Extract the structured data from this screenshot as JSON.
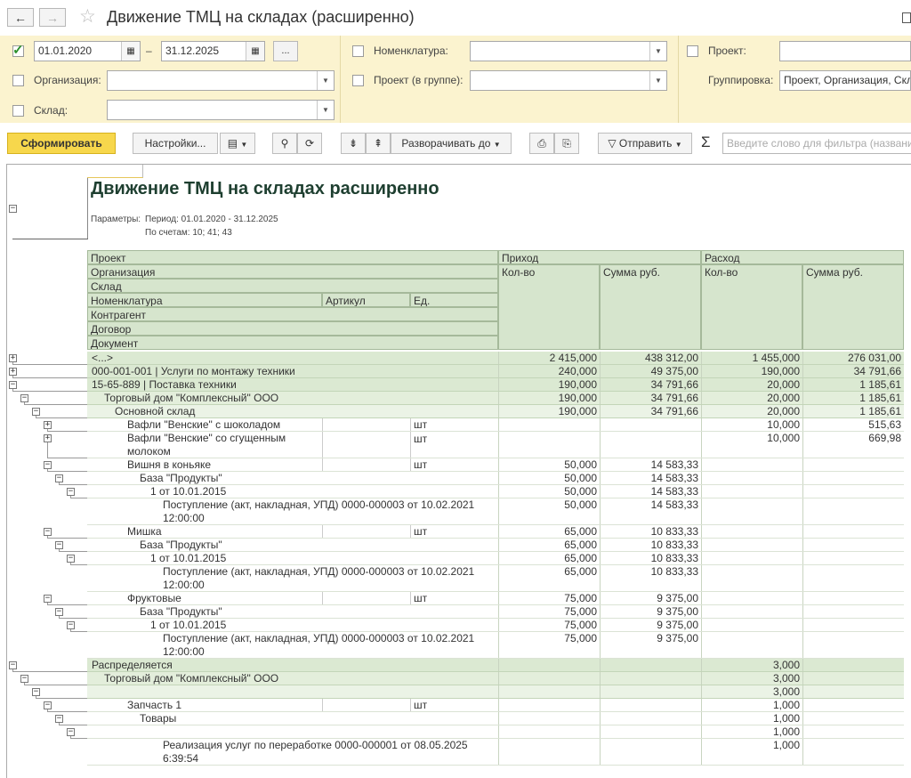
{
  "window": {
    "title": "Движение ТМЦ на складах (расширенно)",
    "back_icon": "←",
    "forward_icon": "→"
  },
  "filters": {
    "period": {
      "checked": true,
      "from": "01.01.2020",
      "dash": "–",
      "to": "31.12.2025",
      "more_label": "..."
    },
    "organization_label": "Организация:",
    "warehouse_label": "Склад:",
    "nomenclature_label": "Номенклатура:",
    "project_group_label": "Проект (в группе):",
    "project_label": "Проект:",
    "grouping_label": "Группировка:",
    "grouping_value": "Проект, Организация, Склад"
  },
  "toolbar": {
    "generate_label": "Сформировать",
    "settings_label": "Настройки...",
    "expand_label": "Разворачивать до",
    "send_label": "Отправить",
    "filter_placeholder": "Введите слово для фильтра (название"
  },
  "report": {
    "title": "Движение ТМЦ на складах расширенно",
    "param_label": "Параметры:",
    "param_period": "Период: 01.01.2020 - 31.12.2025",
    "param_accounts": "По счетам: 10; 41; 43",
    "headers": {
      "project": "Проект",
      "organization": "Организация",
      "warehouse": "Склад",
      "nomenclature": "Номенклатура",
      "article": "Артикул",
      "unit": "Ед.",
      "counterparty": "Контрагент",
      "contract": "Договор",
      "document": "Документ",
      "income": "Приход",
      "expense": "Расход",
      "qty": "Кол-во",
      "sum": "Сумма руб."
    },
    "rows": [
      {
        "level": 0,
        "name": "<...>",
        "unit": "",
        "in_qty": "2 415,000",
        "in_sum": "438 312,00",
        "out_qty": "1 455,000",
        "out_sum": "276 031,00",
        "tree": "+"
      },
      {
        "level": 0,
        "name": "000-001-001 | Услуги по монтажу техники",
        "unit": "",
        "in_qty": "240,000",
        "in_sum": "49 375,00",
        "out_qty": "190,000",
        "out_sum": "34 791,66",
        "tree": "+"
      },
      {
        "level": 0,
        "name": "15-65-889 | Поставка техники",
        "unit": "",
        "in_qty": "190,000",
        "in_sum": "34 791,66",
        "out_qty": "20,000",
        "out_sum": "1 185,61",
        "tree": "-"
      },
      {
        "level": 1,
        "name": "Торговый дом \"Комплексный\" ООО",
        "unit": "",
        "in_qty": "190,000",
        "in_sum": "34 791,66",
        "out_qty": "20,000",
        "out_sum": "1 185,61",
        "tree": "-"
      },
      {
        "level": 2,
        "name": "Основной склад",
        "unit": "",
        "in_qty": "190,000",
        "in_sum": "34 791,66",
        "out_qty": "20,000",
        "out_sum": "1 185,61",
        "tree": "-"
      },
      {
        "level": 3,
        "name": "Вафли \"Венские\" с шоколадом",
        "unit": "шт",
        "in_qty": "",
        "in_sum": "",
        "out_qty": "10,000",
        "out_sum": "515,63",
        "tree": "+"
      },
      {
        "level": 3,
        "name": "Вафли \"Венские\" со сгущенным",
        "name2": "молоком",
        "unit": "шт",
        "in_qty": "",
        "in_sum": "",
        "out_qty": "10,000",
        "out_sum": "669,98",
        "tree": "+"
      },
      {
        "level": 3,
        "name": "Вишня в коньяке",
        "unit": "шт",
        "in_qty": "50,000",
        "in_sum": "14 583,33",
        "out_qty": "",
        "out_sum": "",
        "tree": "-"
      },
      {
        "level": 4,
        "name": "База \"Продукты\"",
        "unit": "",
        "in_qty": "50,000",
        "in_sum": "14 583,33",
        "out_qty": "",
        "out_sum": "",
        "tree": "-"
      },
      {
        "level": 5,
        "name": "1 от 10.01.2015",
        "unit": "",
        "in_qty": "50,000",
        "in_sum": "14 583,33",
        "out_qty": "",
        "out_sum": "",
        "tree": "-"
      },
      {
        "level": 6,
        "name": "Поступление (акт, накладная, УПД) 0000-000003 от 10.02.2021",
        "name2": "12:00:00",
        "unit": "",
        "in_qty": "50,000",
        "in_sum": "14 583,33",
        "out_qty": "",
        "out_sum": ""
      },
      {
        "level": 3,
        "name": "Мишка",
        "unit": "шт",
        "in_qty": "65,000",
        "in_sum": "10 833,33",
        "out_qty": "",
        "out_sum": "",
        "tree": "-"
      },
      {
        "level": 4,
        "name": "База \"Продукты\"",
        "unit": "",
        "in_qty": "65,000",
        "in_sum": "10 833,33",
        "out_qty": "",
        "out_sum": "",
        "tree": "-"
      },
      {
        "level": 5,
        "name": "1 от 10.01.2015",
        "unit": "",
        "in_qty": "65,000",
        "in_sum": "10 833,33",
        "out_qty": "",
        "out_sum": "",
        "tree": "-"
      },
      {
        "level": 6,
        "name": "Поступление (акт, накладная, УПД) 0000-000003 от 10.02.2021",
        "name2": "12:00:00",
        "unit": "",
        "in_qty": "65,000",
        "in_sum": "10 833,33",
        "out_qty": "",
        "out_sum": ""
      },
      {
        "level": 3,
        "name": "Фруктовые",
        "unit": "шт",
        "in_qty": "75,000",
        "in_sum": "9 375,00",
        "out_qty": "",
        "out_sum": "",
        "tree": "-"
      },
      {
        "level": 4,
        "name": "База \"Продукты\"",
        "unit": "",
        "in_qty": "75,000",
        "in_sum": "9 375,00",
        "out_qty": "",
        "out_sum": "",
        "tree": "-"
      },
      {
        "level": 5,
        "name": "1 от 10.01.2015",
        "unit": "",
        "in_qty": "75,000",
        "in_sum": "9 375,00",
        "out_qty": "",
        "out_sum": "",
        "tree": "-"
      },
      {
        "level": 6,
        "name": "Поступление (акт, накладная, УПД) 0000-000003 от 10.02.2021",
        "name2": "12:00:00",
        "unit": "",
        "in_qty": "75,000",
        "in_sum": "9 375,00",
        "out_qty": "",
        "out_sum": ""
      },
      {
        "level": 0,
        "name": "Распределяется",
        "unit": "",
        "in_qty": "",
        "in_sum": "",
        "out_qty": "3,000",
        "out_sum": "",
        "tree": "-"
      },
      {
        "level": 1,
        "name": "Торговый дом \"Комплексный\" ООО",
        "unit": "",
        "in_qty": "",
        "in_sum": "",
        "out_qty": "3,000",
        "out_sum": "",
        "tree": "-"
      },
      {
        "level": 2,
        "name": "",
        "unit": "",
        "in_qty": "",
        "in_sum": "",
        "out_qty": "3,000",
        "out_sum": "",
        "tree": "-"
      },
      {
        "level": 3,
        "name": "Запчасть 1",
        "unit": "шт",
        "in_qty": "",
        "in_sum": "",
        "out_qty": "1,000",
        "out_sum": "",
        "tree": "-"
      },
      {
        "level": 4,
        "name": "Товары",
        "unit": "",
        "in_qty": "",
        "in_sum": "",
        "out_qty": "1,000",
        "out_sum": "",
        "tree": "-"
      },
      {
        "level": 5,
        "name": "",
        "unit": "",
        "in_qty": "",
        "in_sum": "",
        "out_qty": "1,000",
        "out_sum": "",
        "tree": "-"
      },
      {
        "level": 6,
        "name": "Реализация услуг по переработке 0000-000001 от 08.05.2025",
        "name2": "6:39:54",
        "unit": "",
        "in_qty": "",
        "in_sum": "",
        "out_qty": "1,000",
        "out_sum": ""
      }
    ]
  }
}
